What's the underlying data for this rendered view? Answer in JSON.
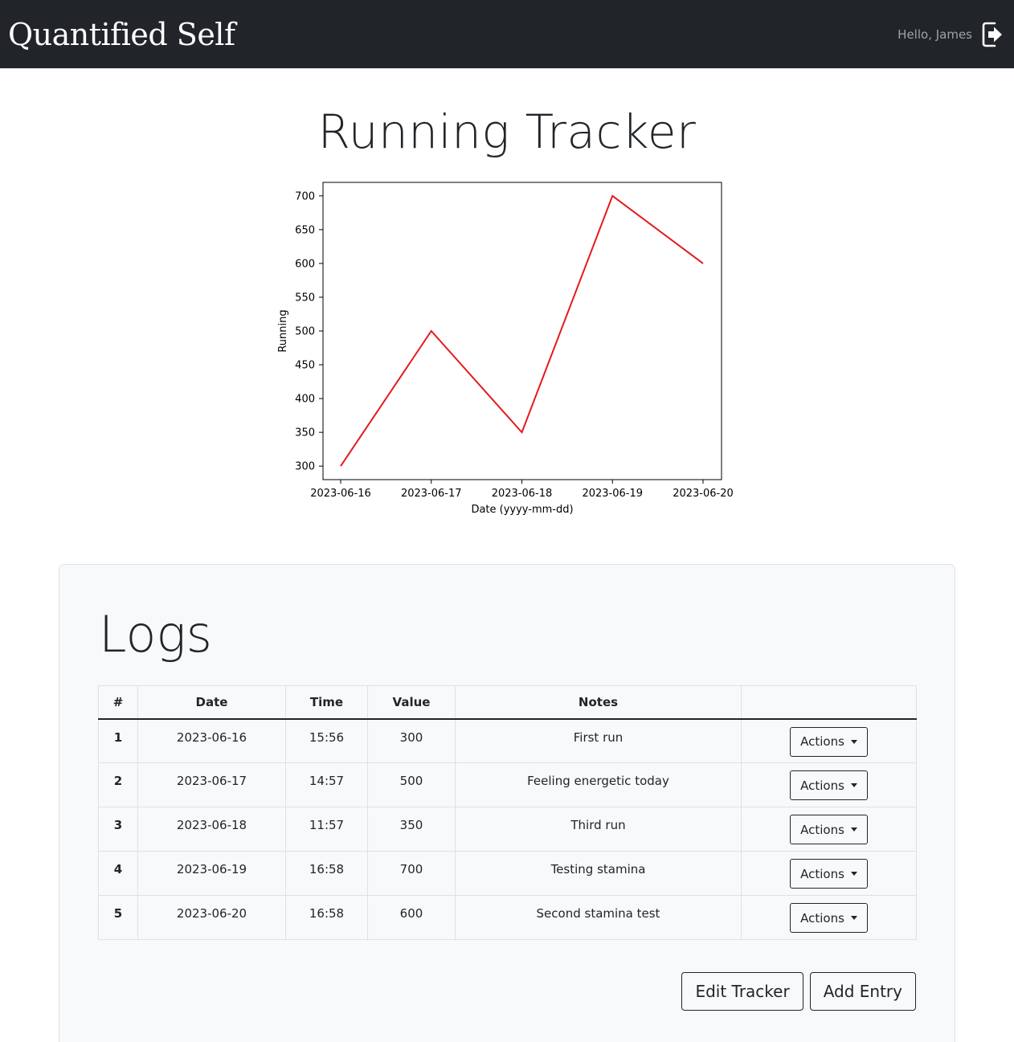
{
  "navbar": {
    "brand": "Quantified Self",
    "greeting": "Hello, James",
    "logout_icon": "logout-icon"
  },
  "page_title": "Running Tracker",
  "chart_data": {
    "type": "line",
    "title": "",
    "xlabel": "Date (yyyy-mm-dd)",
    "ylabel": "Running",
    "x": [
      "2023-06-16",
      "2023-06-17",
      "2023-06-18",
      "2023-06-19",
      "2023-06-20"
    ],
    "series": [
      {
        "values": [
          300,
          500,
          350,
          700,
          600
        ],
        "color": "#e41a1c"
      }
    ],
    "ylim": [
      280,
      720
    ],
    "yticks": [
      300,
      350,
      400,
      450,
      500,
      550,
      600,
      650,
      700
    ],
    "grid": false
  },
  "logs": {
    "title": "Logs",
    "columns": [
      "#",
      "Date",
      "Time",
      "Value",
      "Notes",
      ""
    ],
    "rows": [
      {
        "num": "1",
        "date": "2023-06-16",
        "time": "15:56",
        "value": "300",
        "notes": "First run",
        "action": "Actions"
      },
      {
        "num": "2",
        "date": "2023-06-17",
        "time": "14:57",
        "value": "500",
        "notes": "Feeling energetic today",
        "action": "Actions"
      },
      {
        "num": "3",
        "date": "2023-06-18",
        "time": "11:57",
        "value": "350",
        "notes": "Third run",
        "action": "Actions"
      },
      {
        "num": "4",
        "date": "2023-06-19",
        "time": "16:58",
        "value": "700",
        "notes": "Testing stamina",
        "action": "Actions"
      },
      {
        "num": "5",
        "date": "2023-06-20",
        "time": "16:58",
        "value": "600",
        "notes": "Second stamina test",
        "action": "Actions"
      }
    ],
    "edit_label": "Edit Tracker",
    "add_label": "Add Entry"
  }
}
